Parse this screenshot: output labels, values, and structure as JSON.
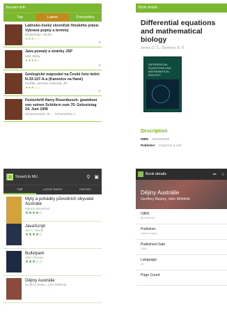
{
  "screen1": {
    "app_title": "Seznam knih",
    "tabs": [
      {
        "label": "Top",
        "active": false
      },
      {
        "label": "Latest",
        "active": true
      },
      {
        "label": "Favourites",
        "active": false
      }
    ],
    "items": [
      {
        "title": "Latinsko-český slovníček římského práva: Vybrané pojmy a termíny",
        "author": "Brzybohatý, Václav",
        "rating": "★★★☆☆",
        "count": "4"
      },
      {
        "title": "Java pomalý a stránky JSP",
        "author": "Hall, Marty",
        "rating": "★★★★☆",
        "count": "3"
      },
      {
        "title": "Geologické mapování na České listu dolní: N-33-107-A-a (Kanovice na Hané)",
        "author": "Dvořák, Jaroslav; Kalvoda, Jiří",
        "rating": "★★★☆☆",
        "count": "3"
      },
      {
        "title": "Festschrift Harry Rosenbusch: gewidmet von seinen Schülern zum 70. Geburtstag 24. Juni 1906",
        "author": "Schoenemeier, W. ... Schumacher, L.",
        "rating": "",
        "count": ""
      }
    ]
  },
  "screen2": {
    "app_title": "Book details",
    "title": "Differential equations and mathematical biology",
    "authors": "Jones, D. S., Sleeman, B. D.",
    "cover_title": "DIFFERENTIAL EQUATIONS AND MATHEMATICAL BIOLOGY",
    "description_label": "Description",
    "isbn_label": "ISBN",
    "isbn_value": "1584883588",
    "publisher_label": "Publisher",
    "publisher_value": "Chapman & Hall"
  },
  "screen3": {
    "app_name": "SmartLib MU",
    "tabs": [
      {
        "label": "TOP",
        "active": true
      },
      {
        "label": "LATEST RATED",
        "active": false
      },
      {
        "label": "HISTORY",
        "active": false
      }
    ],
    "items": [
      {
        "title": "Mýty a pohádky původních obyvatel Austrálie",
        "author": "Patricia Mountford",
        "rating": "★★★★☆",
        "thumb_color": "#d4a23a"
      },
      {
        "title": "JavaScript",
        "author": "Jan C. Nevrlý",
        "rating": "★★★★☆",
        "thumb_color": "#25324a"
      },
      {
        "title": "Bulletpark",
        "author": "John Cheever",
        "rating": "★★★☆☆",
        "thumb_color": "#1e2a44"
      },
      {
        "title": "Dějiny Austrálie",
        "author": "Geoffrey Bolton, John Whitfield",
        "rating": "",
        "thumb_color": "#8a4a3c"
      }
    ]
  },
  "screen4": {
    "app_title": "Book details",
    "hero_title": "Dějiny Austrálie",
    "hero_authors": "Geoffrey Blainey, John Whitfield",
    "fields": [
      {
        "label": "ISBN",
        "value": "8071062327"
      },
      {
        "label": "Publisher",
        "value": "Lidové noviny"
      },
      {
        "label": "Published Date",
        "value": "1998"
      },
      {
        "label": "Language",
        "value": "cs"
      },
      {
        "label": "Page Count",
        "value": ""
      }
    ]
  },
  "colors": {
    "accent": "#7cb82f",
    "tab_active": "#c08a1e",
    "dark_bar": "#363636"
  }
}
